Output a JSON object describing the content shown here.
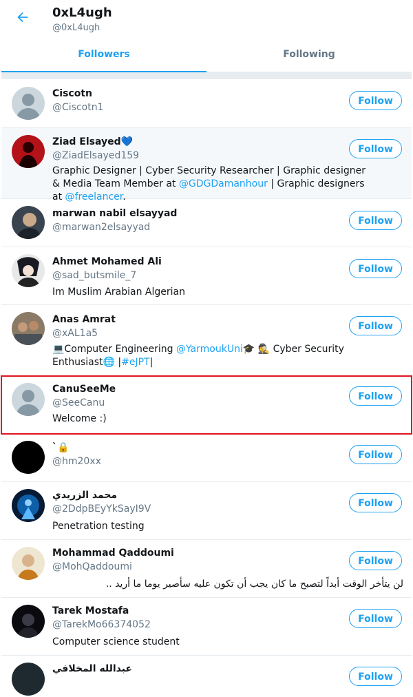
{
  "header": {
    "name": "0xL4ugh",
    "handle": "@0xL4ugh"
  },
  "tabs": [
    {
      "label": "Followers"
    },
    {
      "label": "Following"
    }
  ],
  "accent": "#1da1f2",
  "follow_label": "Follow",
  "users": [
    {
      "name": "Ciscotn",
      "handle": "@Ciscotn1"
    },
    {
      "name": "Ziad Elsayed💙",
      "handle": "@ZiadElsayed159",
      "bio_a": "Graphic Designer | Cyber Security Researcher | Graphic designer & Media Team Member at ",
      "bio_link1": "@GDGDamanhour",
      "bio_b": " | Graphic designers at ",
      "bio_link2": "@freelancer",
      "bio_c": "."
    },
    {
      "name": "marwan nabil elsayyad",
      "handle": "@marwan2elsayyad"
    },
    {
      "name": "Ahmet Mohamed Ali",
      "handle": "@sad_butsmile_7",
      "bio": "Im Muslim Arabian Algerian"
    },
    {
      "name": "Anas Amrat",
      "handle": "@xAL1a5",
      "bio_a": "💻Computer Engineering ",
      "bio_link1": "@YarmoukUni",
      "bio_b": "🎓 🕵 Cyber Security Enthusiast🌐 |",
      "bio_link2": "#eJPT",
      "bio_c": "|"
    },
    {
      "name": "CanuSeeMe",
      "handle": "@SeeCanu",
      "bio": "Welcome :)"
    },
    {
      "name": "`🔒",
      "handle": "@hm20xx"
    },
    {
      "name": "محمد الزريدي",
      "handle": "@2DdpBEyYkSayI9V",
      "bio": "Penetration testing"
    },
    {
      "name": "Mohammad Qaddoumi",
      "handle": "@MohQaddoumi",
      "bio": "لن يتأخر الوقت أبداً لتصبح ما كان يجب أن تكون عليه سأصير يوما ما أريد .."
    },
    {
      "name": "Tarek Mostafa",
      "handle": "@TarekMo66374052",
      "bio": "Computer science student"
    },
    {
      "name": "عبدالله المخلافي"
    }
  ]
}
